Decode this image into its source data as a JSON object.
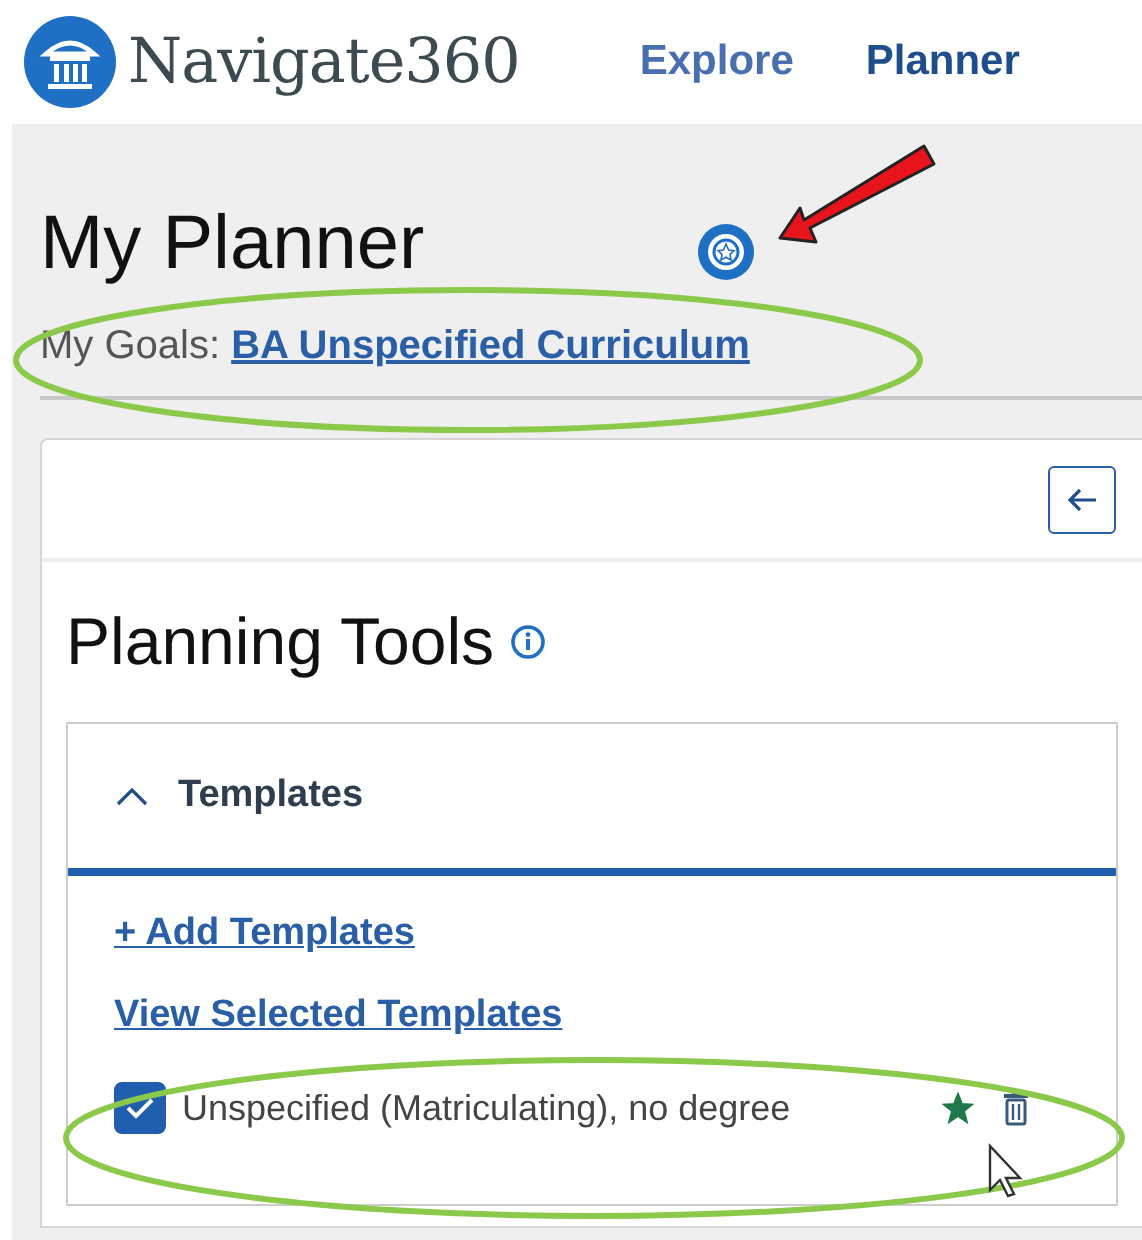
{
  "header": {
    "brand": "Navigate360",
    "nav": [
      {
        "label": "Explore",
        "selected": false
      },
      {
        "label": "Planner",
        "selected": true
      }
    ]
  },
  "page": {
    "title": "My Planner",
    "goals_label": "My Goals:",
    "goals_link": "BA Unspecified Curriculum"
  },
  "panel": {
    "title": "Planning Tools",
    "accordion": {
      "title": "Templates",
      "expanded": true,
      "links": [
        "+ Add Templates",
        "View Selected Templates"
      ],
      "templates": [
        {
          "label": "Unspecified (Matriculating), no degree",
          "checked": true,
          "starred": true
        }
      ]
    }
  }
}
